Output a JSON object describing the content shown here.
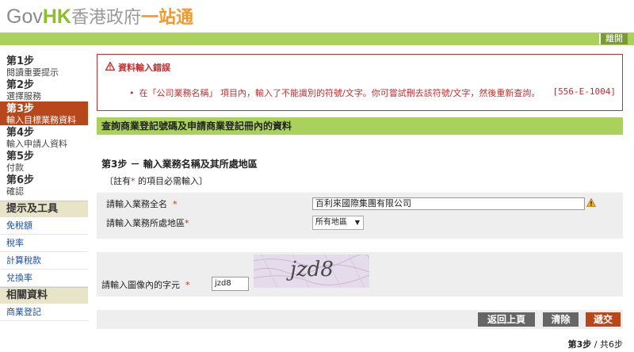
{
  "header": {
    "logo_gov": "Gov",
    "logo_hk": "HK",
    "logo_zh1": "香港政府",
    "logo_zh2": "一站通",
    "logout_label": "離開"
  },
  "sidebar": {
    "steps": [
      {
        "title": "第1步",
        "sub": "閱讀重要提示"
      },
      {
        "title": "第2步",
        "sub": "選擇服務"
      },
      {
        "title": "第3步",
        "sub": "輸入目標業務資料"
      },
      {
        "title": "第4步",
        "sub": "輸入申請人資料"
      },
      {
        "title": "第5步",
        "sub": "付款"
      },
      {
        "title": "第6步",
        "sub": "確認"
      }
    ],
    "tools_heading": "提示及工具",
    "tools": [
      "免稅額",
      "稅率",
      "計算稅款",
      "兌換率"
    ],
    "related_heading": "相關資料",
    "related": [
      "商業登記"
    ]
  },
  "error": {
    "title": "資料輸入錯誤",
    "message": "在「公司業務名稱」 項目內，輸入了不能識別的符號/文字。你可嘗試刪去該符號/文字，然後重新查詢。",
    "code": "[556-E-1004]"
  },
  "section_title": "查詢商業登記號碼及申請商業登記冊內的資料",
  "step_heading": "第3步 － 輸入業務名稱及其所處地區",
  "note_prefix": "〔註有",
  "note_star": "*",
  "note_suffix": " 的項目必需輸入〕",
  "form": {
    "name_label": "請輸入業務全名",
    "name_value": "百利來國際集團有限公司",
    "region_label": "請輸入業務所處地區",
    "region_value": "所有地區",
    "captcha_label": "請輸入圖像內的字元",
    "captcha_value": "jzd8",
    "captcha_image_text": "jzd8",
    "required_star": "*"
  },
  "buttons": {
    "back": "返回上頁",
    "clear": "清除",
    "submit": "遞交"
  },
  "pager": {
    "current": "第3步",
    "total": " / 共6步"
  },
  "colors": {
    "brand_green": "#a9d15b",
    "active_step": "#b8481c",
    "error_red": "#c03030"
  }
}
